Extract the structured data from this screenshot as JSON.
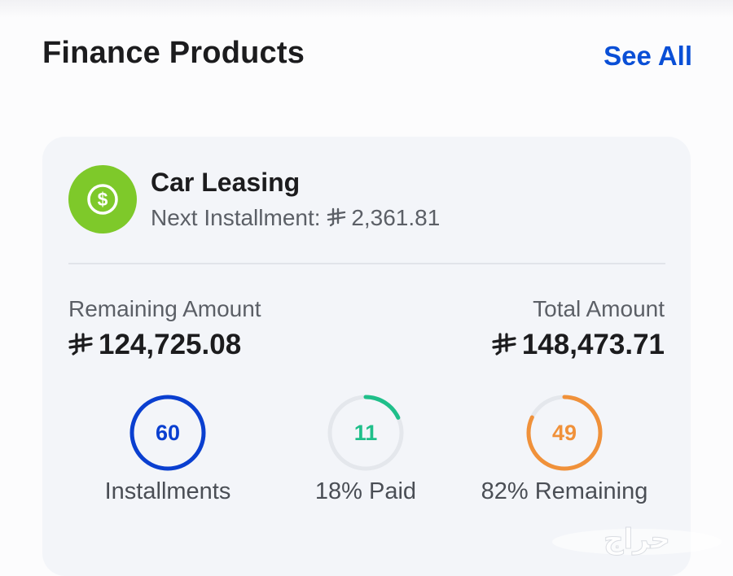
{
  "header": {
    "title": "Finance Products",
    "see_all": "See All"
  },
  "product": {
    "icon": "dollar-coin-icon",
    "icon_color": "#7ec92a",
    "title": "Car Leasing",
    "next_installment_label": "Next Installment:",
    "next_installment_value": "2,361.81"
  },
  "amounts": {
    "remaining_label": "Remaining Amount",
    "remaining_value": "124,725.08",
    "total_label": "Total Amount",
    "total_value": "148,473.71"
  },
  "stats": [
    {
      "value": "60",
      "label": "Installments",
      "progress": 1.0,
      "color": "#0a3fd0"
    },
    {
      "value": "11",
      "label": "18% Paid",
      "progress": 0.18,
      "color": "#1fbf8a"
    },
    {
      "value": "49",
      "label": "82% Remaining",
      "progress": 0.82,
      "color": "#f0913a"
    }
  ],
  "colors": {
    "accent": "#0a4fd6",
    "track": "#e4e7ec"
  },
  "watermark": {
    "text": "حراج"
  }
}
